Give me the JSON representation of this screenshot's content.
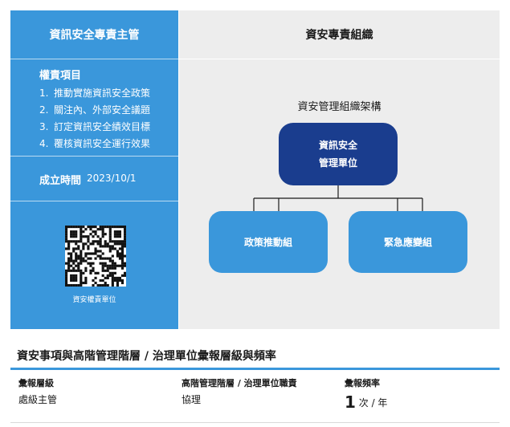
{
  "left_panel": {
    "title": "資訊安全專責主管",
    "duties_title": "權責項目",
    "duties": [
      {
        "num": "1.",
        "text": "推動實施資訊安全政策"
      },
      {
        "num": "2.",
        "text": "關注內、外部安全議題"
      },
      {
        "num": "3.",
        "text": "訂定資訊安全績效目標"
      },
      {
        "num": "4.",
        "text": "覆核資訊安全運行效果"
      }
    ],
    "established_label": "成立時間",
    "established_date": "2023/10/1",
    "qr_caption": "資安權責單位"
  },
  "right_panel": {
    "title": "資安專責組織",
    "chart_title": "資安管理組織架構",
    "top_node": {
      "line1": "資訊安全",
      "line2": "管理單位"
    },
    "children": [
      "政策推動組",
      "緊急應變組"
    ]
  },
  "reporting": {
    "title": "資安事項與高階管理階層 / 治理單位彙報層級與頻率",
    "headers": [
      "彙報層級",
      "高階管理階層 / 治理單位職責",
      "彙報頻率"
    ],
    "level": "處級主管",
    "duty": "協理",
    "frequency_number": "1",
    "frequency_unit": "次 / 年"
  },
  "colors": {
    "accent": "#3a97db",
    "dark_node": "#1a3d8e",
    "panel_gray": "#ededed"
  },
  "icons": {
    "qr": "qr-code-icon"
  }
}
